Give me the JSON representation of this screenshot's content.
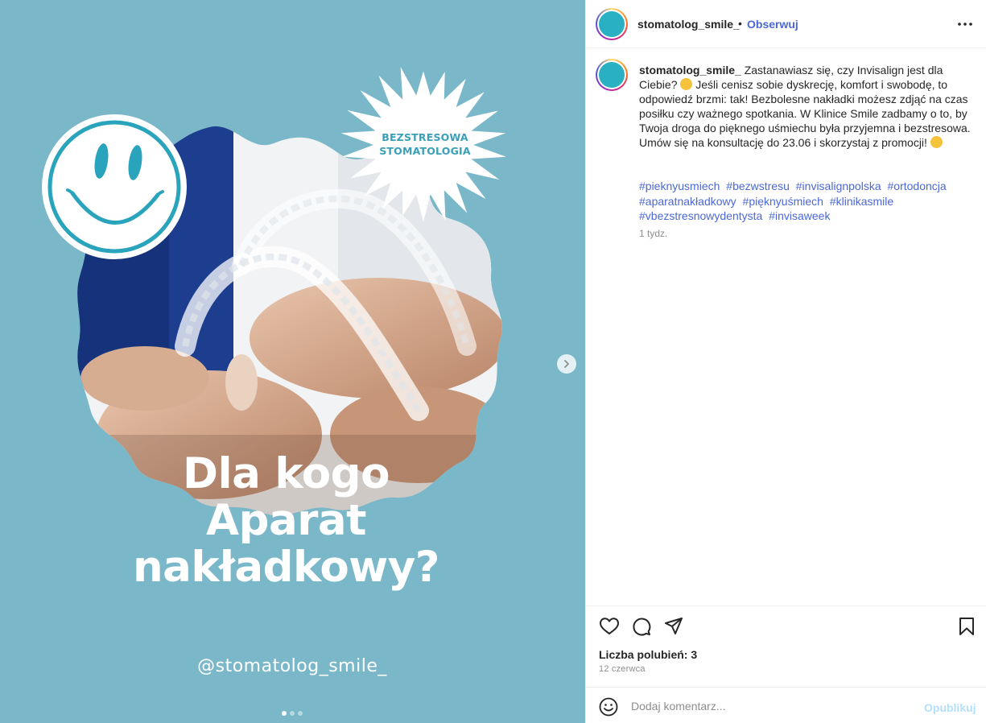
{
  "post": {
    "image": {
      "badge_line1": "BEZSTRESOWA",
      "badge_line2": "STOMATOLOGIA",
      "headline_line1": "Dla kogo",
      "headline_line2": "Aparat",
      "headline_line3": "nakładkowy?",
      "handle": "@stomatolog_smile_",
      "carousel_count": 3,
      "carousel_active": 1,
      "background_color": "#7ab8c9",
      "accent_color": "#2aa3bd"
    },
    "header": {
      "username": "stomatolog_smile_",
      "separator": "•",
      "follow_label": "Obserwuj",
      "more_icon": "more-horizontal-icon"
    },
    "caption": {
      "username": "stomatolog_smile_",
      "text_part1": "Zastanawiasz się, czy Invisalign jest dla Ciebie?",
      "text_part2": "Jeśli cenisz sobie dyskrecję, komfort i swobodę, to odpowiedź brzmi: tak! Bezbolesne nakładki możesz zdjąć na czas posiłku czy ważnego spotkania. W Klinice Smile zadbamy o to, by Twoja droga do pięknego uśmiechu była przyjemna i bezstresowa. Umów się na konsultację do 23.06 i skorzystaj z promocji!",
      "emoji1": "thinking-face-emoji",
      "emoji2": "smiling-face-emoji",
      "hashtags": [
        "#pieknyusmiech",
        "#bezwstresu",
        "#invisalignpolska",
        "#ortodoncja",
        "#aparatnakładkowy",
        "#pięknyuśmiech",
        "#klinikasmile",
        "#vbezstresnowydentysta",
        "#invisaweek"
      ],
      "time_ago": "1 tydz."
    },
    "actions": {
      "like_icon": "heart-icon",
      "comment_icon": "comment-icon",
      "share_icon": "send-icon",
      "save_icon": "bookmark-icon"
    },
    "likes_text": "Liczba polubień: 3",
    "date": "12 czerwca",
    "comment": {
      "placeholder": "Dodaj komentarz...",
      "publish_label": "Opublikuj",
      "emoji_icon": "emoji-icon"
    },
    "link_color": "#4c68d7",
    "follow_color": "#4c68d7"
  }
}
